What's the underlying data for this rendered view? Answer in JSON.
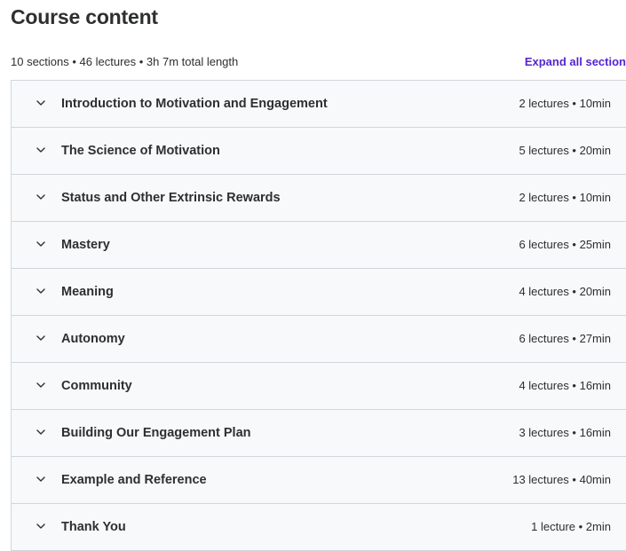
{
  "header": {
    "title": "Course content",
    "summary": "10 sections • 46 lectures • 3h 7m total length",
    "expand_label": "Expand all section"
  },
  "sections": [
    {
      "title": "Introduction to Motivation and Engagement",
      "meta": "2 lectures • 10min"
    },
    {
      "title": "The Science of Motivation",
      "meta": "5 lectures • 20min"
    },
    {
      "title": "Status and Other Extrinsic Rewards",
      "meta": "2 lectures • 10min"
    },
    {
      "title": "Mastery",
      "meta": "6 lectures • 25min"
    },
    {
      "title": "Meaning",
      "meta": "4 lectures • 20min"
    },
    {
      "title": "Autonomy",
      "meta": "6 lectures • 27min"
    },
    {
      "title": "Community",
      "meta": "4 lectures • 16min"
    },
    {
      "title": "Building Our Engagement Plan",
      "meta": "3 lectures • 16min"
    },
    {
      "title": "Example and Reference",
      "meta": "13 lectures • 40min"
    },
    {
      "title": "Thank You",
      "meta": "1 lecture • 2min"
    }
  ],
  "icons": {
    "section_toggle": "chevron-down-icon"
  },
  "colors": {
    "text": "#2d2f31",
    "accent": "#5624d0",
    "row_background": "#f7f9fa",
    "border": "#d1d7dc"
  }
}
